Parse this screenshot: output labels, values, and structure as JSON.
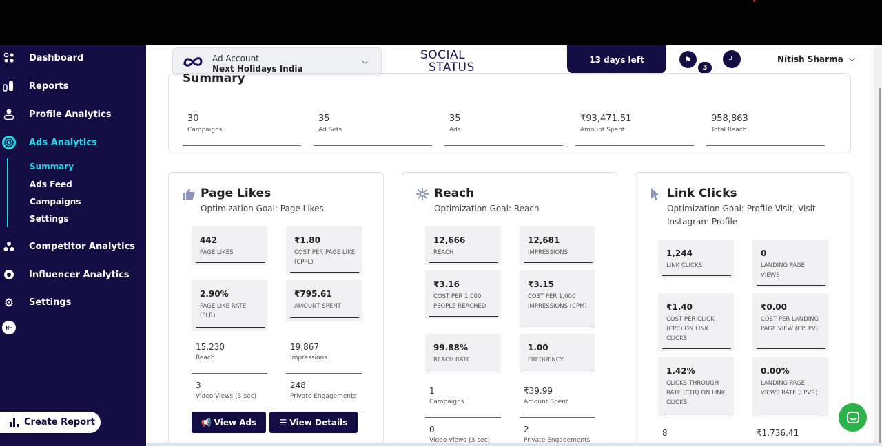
{
  "sidebar": {
    "items": [
      {
        "label": "Dashboard",
        "icon": "grid-icon"
      },
      {
        "label": "Reports",
        "icon": "reports-icon"
      },
      {
        "label": "Profile Analytics",
        "icon": "profile-icon"
      },
      {
        "label": "Ads Analytics",
        "icon": "target-icon"
      },
      {
        "label": "Competitor Analytics",
        "icon": "competitor-icon"
      },
      {
        "label": "Influencer Analytics",
        "icon": "influencer-icon"
      },
      {
        "label": "Settings",
        "icon": "gear-icon"
      }
    ],
    "subitems": [
      "Summary",
      "Ads Feed",
      "Campaigns",
      "Settings"
    ],
    "create_report": "Create Report"
  },
  "header": {
    "account_label": "Ad Account",
    "account_name": "Next Holidays India",
    "logo_line1": "SOCIAL",
    "logo_line2": "STATUS",
    "days_left": "13 days left",
    "flag_badge": "3",
    "user": "Nitish Sharma"
  },
  "summary": {
    "title": "Summary",
    "cells": [
      {
        "value": "30",
        "label": "Campaigns"
      },
      {
        "value": "35",
        "label": "Ad Sets"
      },
      {
        "value": "35",
        "label": "Ads"
      },
      {
        "value": "₹93,471.51",
        "label": "Amount Spent"
      },
      {
        "value": "958,863",
        "label": "Total Reach"
      }
    ]
  },
  "cards": {
    "page_likes": {
      "title": "Page Likes",
      "goal": "Optimization Goal: Page Likes",
      "boxes": [
        {
          "value": "442",
          "label": "PAGE LIKES"
        },
        {
          "value": "₹1.80",
          "label": "COST PER PAGE LIKE (CPPL)"
        },
        {
          "value": "2.90%",
          "label": "PAGE LIKE RATE (PLR)"
        },
        {
          "value": "₹795.61",
          "label": "AMOUNT SPENT"
        }
      ],
      "plain": [
        {
          "value": "15,230",
          "label": "Reach"
        },
        {
          "value": "19,867",
          "label": "Impressions"
        },
        {
          "value": "3",
          "label": "Video Views (3-sec)"
        },
        {
          "value": "248",
          "label": "Private Engagements"
        }
      ],
      "view_ads": "View Ads",
      "view_details": "View Details"
    },
    "reach": {
      "title": "Reach",
      "goal": "Optimization Goal: Reach",
      "boxes": [
        {
          "value": "12,666",
          "label": "REACH"
        },
        {
          "value": "12,681",
          "label": "IMPRESSIONS"
        },
        {
          "value": "₹3.16",
          "label": "COST PER 1,000 PEOPLE REACHED"
        },
        {
          "value": "₹3.15",
          "label": "COST PER 1,000 IMPRESSIONS (CPM)"
        },
        {
          "value": "99.88%",
          "label": "REACH RATE"
        },
        {
          "value": "1.00",
          "label": "FREQUENCY"
        }
      ],
      "plain": [
        {
          "value": "1",
          "label": "Campaigns"
        },
        {
          "value": "₹39.99",
          "label": "Amount Spent"
        },
        {
          "value": "0",
          "label": "Video Views (3-sec)"
        },
        {
          "value": "2",
          "label": "Private Engagements"
        }
      ]
    },
    "link_clicks": {
      "title": "Link Clicks",
      "goal": "Optimization Goal: Profile Visit, Visit Instagram Profile",
      "boxes": [
        {
          "value": "1,244",
          "label": "LINK CLICKS"
        },
        {
          "value": "0",
          "label": "LANDING PAGE VIEWS"
        },
        {
          "value": "₹1.40",
          "label": "COST PER CLICK (CPC) ON LINK CLICKS"
        },
        {
          "value": "₹0.00",
          "label": "COST PER LANDING PAGE VIEW (CPLPV)"
        },
        {
          "value": "1.42%",
          "label": "CLICKS THROUGH RATE (CTR) ON LINK CLICKS"
        },
        {
          "value": "0.00%",
          "label": "LANDING PAGE VIEWS RATE (LPVR)"
        }
      ],
      "plain": [
        {
          "value": "8",
          "label": ""
        },
        {
          "value": "₹1,736.41",
          "label": ""
        }
      ]
    }
  }
}
